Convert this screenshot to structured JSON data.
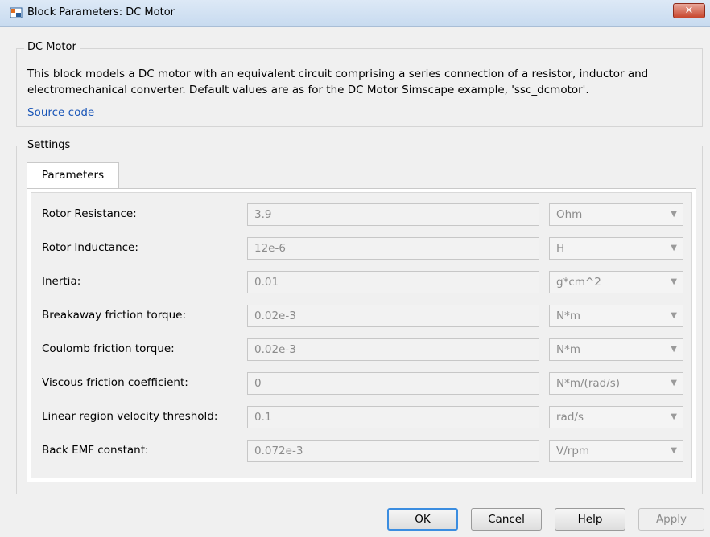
{
  "window": {
    "title": "Block Parameters: DC Motor",
    "close_glyph": "✕",
    "icon": "simulink-block-icon"
  },
  "block": {
    "group_title": "DC Motor",
    "description": "This block models a DC motor with an equivalent circuit comprising a series connection of a resistor, inductor and electromechanical converter. Default values are as for the DC Motor Simscape example, 'ssc_dcmotor'.",
    "source_link": "Source code"
  },
  "settings": {
    "group_title": "Settings",
    "tab_label": "Parameters",
    "parameters": [
      {
        "label": "Rotor Resistance:",
        "value": "3.9",
        "unit": "Ohm"
      },
      {
        "label": "Rotor Inductance:",
        "value": "12e-6",
        "unit": "H"
      },
      {
        "label": "Inertia:",
        "value": "0.01",
        "unit": "g*cm^2"
      },
      {
        "label": "Breakaway friction torque:",
        "value": "0.02e-3",
        "unit": "N*m"
      },
      {
        "label": "Coulomb friction torque:",
        "value": "0.02e-3",
        "unit": "N*m"
      },
      {
        "label": "Viscous friction coefficient:",
        "value": "0",
        "unit": "N*m/(rad/s)"
      },
      {
        "label": "Linear region velocity threshold:",
        "value": "0.1",
        "unit": "rad/s"
      },
      {
        "label": "Back EMF constant:",
        "value": "0.072e-3",
        "unit": "V/rpm"
      }
    ]
  },
  "buttons": {
    "ok": "OK",
    "cancel": "Cancel",
    "help": "Help",
    "apply": "Apply"
  },
  "colors": {
    "link": "#1a56b8",
    "default_button_border": "#3b8de0",
    "close_button": "#c7452c"
  }
}
